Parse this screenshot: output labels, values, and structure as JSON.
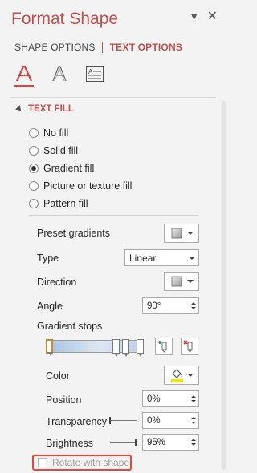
{
  "pane": {
    "title": "Format Shape",
    "dropdown_icon": "triangle-down-icon",
    "close_icon": "close-icon"
  },
  "tabs": [
    {
      "label": "SHAPE OPTIONS"
    },
    {
      "label": "TEXT OPTIONS"
    }
  ],
  "icons": [
    "text-fill-outline-icon",
    "text-effects-icon",
    "textbox-icon"
  ],
  "text_fill": {
    "header": "TEXT FILL",
    "options": [
      {
        "label": "No fill",
        "selected": false
      },
      {
        "label": "Solid fill",
        "selected": false
      },
      {
        "label": "Gradient fill",
        "selected": true
      },
      {
        "label": "Picture or texture fill",
        "selected": false
      },
      {
        "label": "Pattern fill",
        "selected": false
      }
    ]
  },
  "props": {
    "preset_gradients": "Preset gradients",
    "type_label": "Type",
    "type_value": "Linear",
    "direction_label": "Direction",
    "angle_label": "Angle",
    "angle_value": "90°",
    "gradient_stops": "Gradient stops",
    "color_label": "Color",
    "position_label": "Position",
    "position_value": "0%",
    "transparency_label": "Transparency",
    "transparency_value": "0%",
    "brightness_label": "Brightness",
    "brightness_value": "95%",
    "rotate_label": "Rotate with shape"
  },
  "colors": {
    "accent": "#c0504d",
    "highlight_border": "#e8443a"
  }
}
